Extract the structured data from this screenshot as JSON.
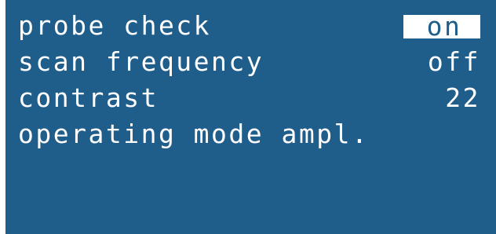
{
  "colors": {
    "background": "#1f5d8a",
    "text": "#ffffff",
    "selection_bg": "#ffffff",
    "selection_text": "#1f5d8a"
  },
  "menu": {
    "items": [
      {
        "label": "probe check",
        "value": "on",
        "selected": true
      },
      {
        "label": "scan frequency",
        "value": "off",
        "selected": false
      },
      {
        "label": "contrast",
        "value": "22",
        "selected": false
      },
      {
        "label": "operating mode ampl.",
        "value": "",
        "selected": false
      }
    ]
  }
}
